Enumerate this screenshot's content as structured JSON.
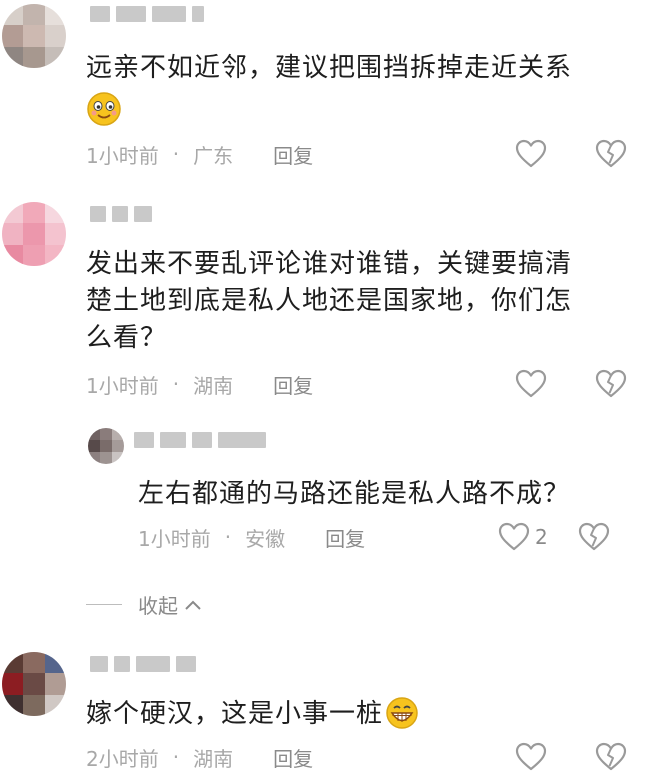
{
  "comments": [
    {
      "text": "远亲不如近邻，建议把围挡拆掉走近关系",
      "emoji": "smiling-face-icon",
      "time": "1小时前",
      "location": "广东",
      "reply": "回复",
      "likes": ""
    },
    {
      "text_lines": [
        "发出来不要乱评论谁对谁错，关键要搞清",
        "楚土地到底是私人地还是国家地，你们怎",
        "么看？"
      ],
      "time": "1小时前",
      "location": "湖南",
      "reply": "回复",
      "likes": ""
    },
    {
      "text": "左右都通的马路还能是私人路不成？",
      "time": "1小时前",
      "location": "安徽",
      "reply": "回复",
      "likes": "2"
    },
    {
      "text": "嫁个硬汉，这是小事一桩",
      "emoji": "grinning-face-icon",
      "time": "2小时前",
      "location": "湖南",
      "reply": "回复",
      "likes": ""
    }
  ],
  "collapse_label": "收起",
  "separator": "·",
  "colors": {
    "like_outline": "#9a9a9a",
    "meta_text": "#a8a8a8",
    "emoji_yellow": "#f7c31e"
  }
}
